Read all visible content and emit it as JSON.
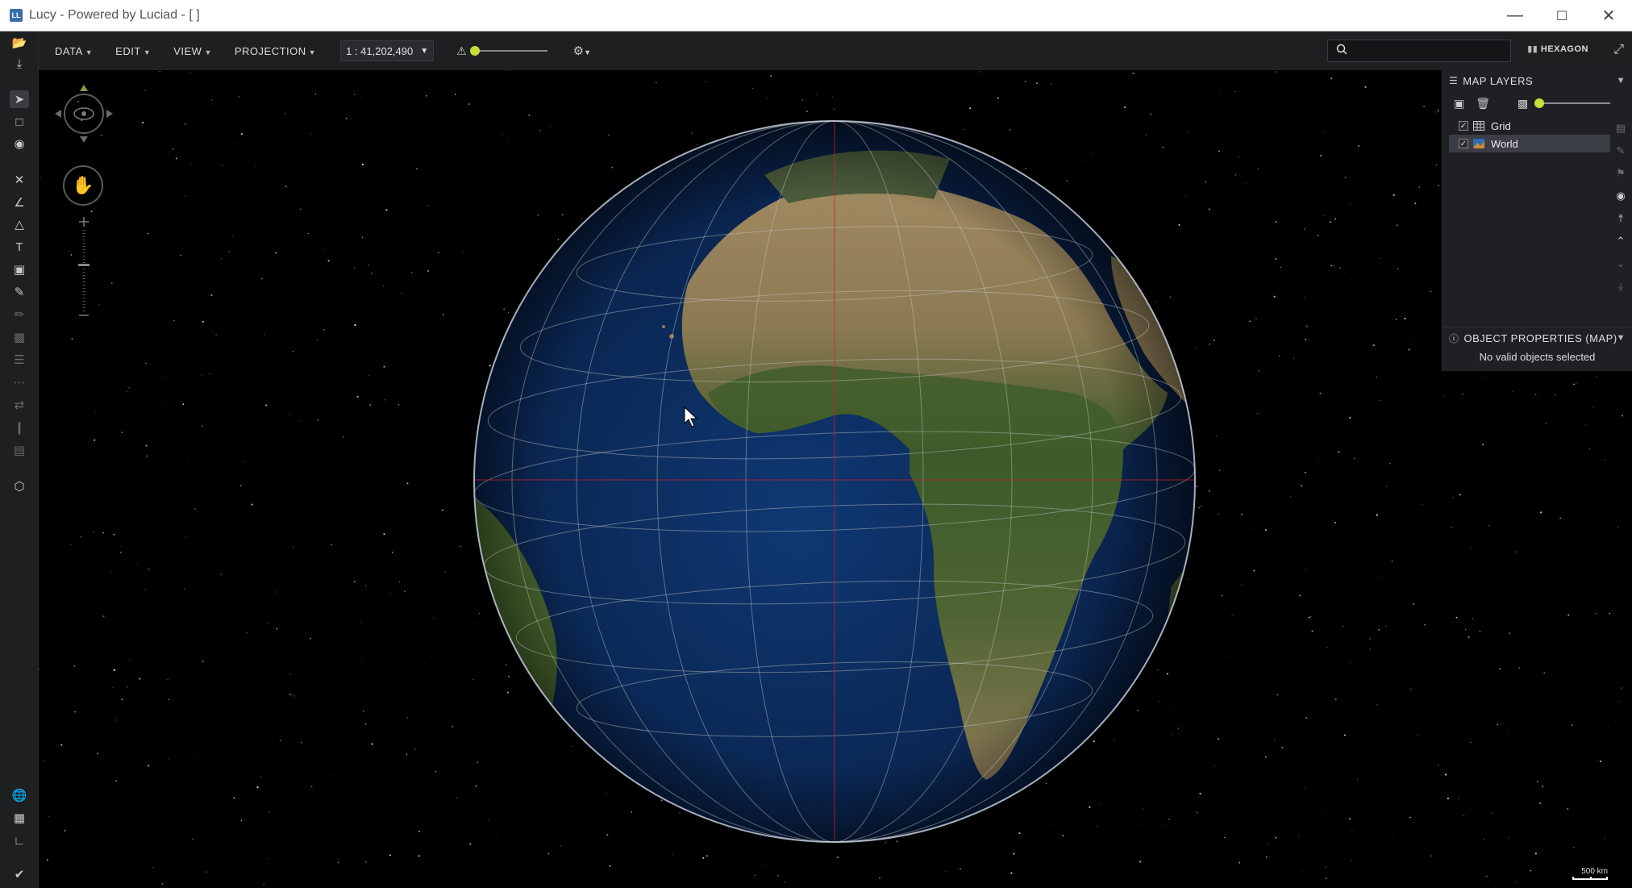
{
  "window": {
    "title": "Lucy - Powered by Luciad - [ ]",
    "app_icon_text": "LL",
    "controls": [
      "minimize",
      "maximize",
      "close"
    ]
  },
  "menu": {
    "items": [
      {
        "label": "DATA"
      },
      {
        "label": "EDIT"
      },
      {
        "label": "VIEW"
      },
      {
        "label": "PROJECTION"
      }
    ],
    "scale_value": "1 : 41,202,490",
    "search_placeholder": "",
    "brand": "HEXAGON"
  },
  "left_toolbar": {
    "icons": [
      "open-folder-icon",
      "download-icon",
      "select-arrow-icon",
      "bookmark-icon",
      "visibility-eye-icon",
      "close-x-icon",
      "polyline-icon",
      "polygon-icon",
      "text-tool-icon",
      "shapes-icon",
      "pen-icon",
      "pencil-icon",
      "style-icon",
      "line-style-icon",
      "dash-style-icon",
      "arrow-style-icon",
      "pin-icon",
      "paint-icon",
      "geometry-icon",
      "globe-layers-icon",
      "table-icon",
      "chart-icon",
      "check-status-icon"
    ]
  },
  "map_layers": {
    "header": "MAP LAYERS",
    "opacity": 0,
    "layers": [
      {
        "name": "Grid",
        "checked": true,
        "selected": false
      },
      {
        "name": "World",
        "checked": true,
        "selected": true
      }
    ]
  },
  "object_properties": {
    "header": "OBJECT PROPERTIES (MAP)",
    "message": "No valid objects selected"
  },
  "map": {
    "scale_bar_label": "500 km",
    "colors": {
      "accent": "#c8dd3a",
      "crosshair": "#d0202a",
      "graticule": "#c8c8c8",
      "ocean": "#0d2a55",
      "land": "#8a7a52"
    }
  },
  "visual_slider": {
    "level": 0
  }
}
